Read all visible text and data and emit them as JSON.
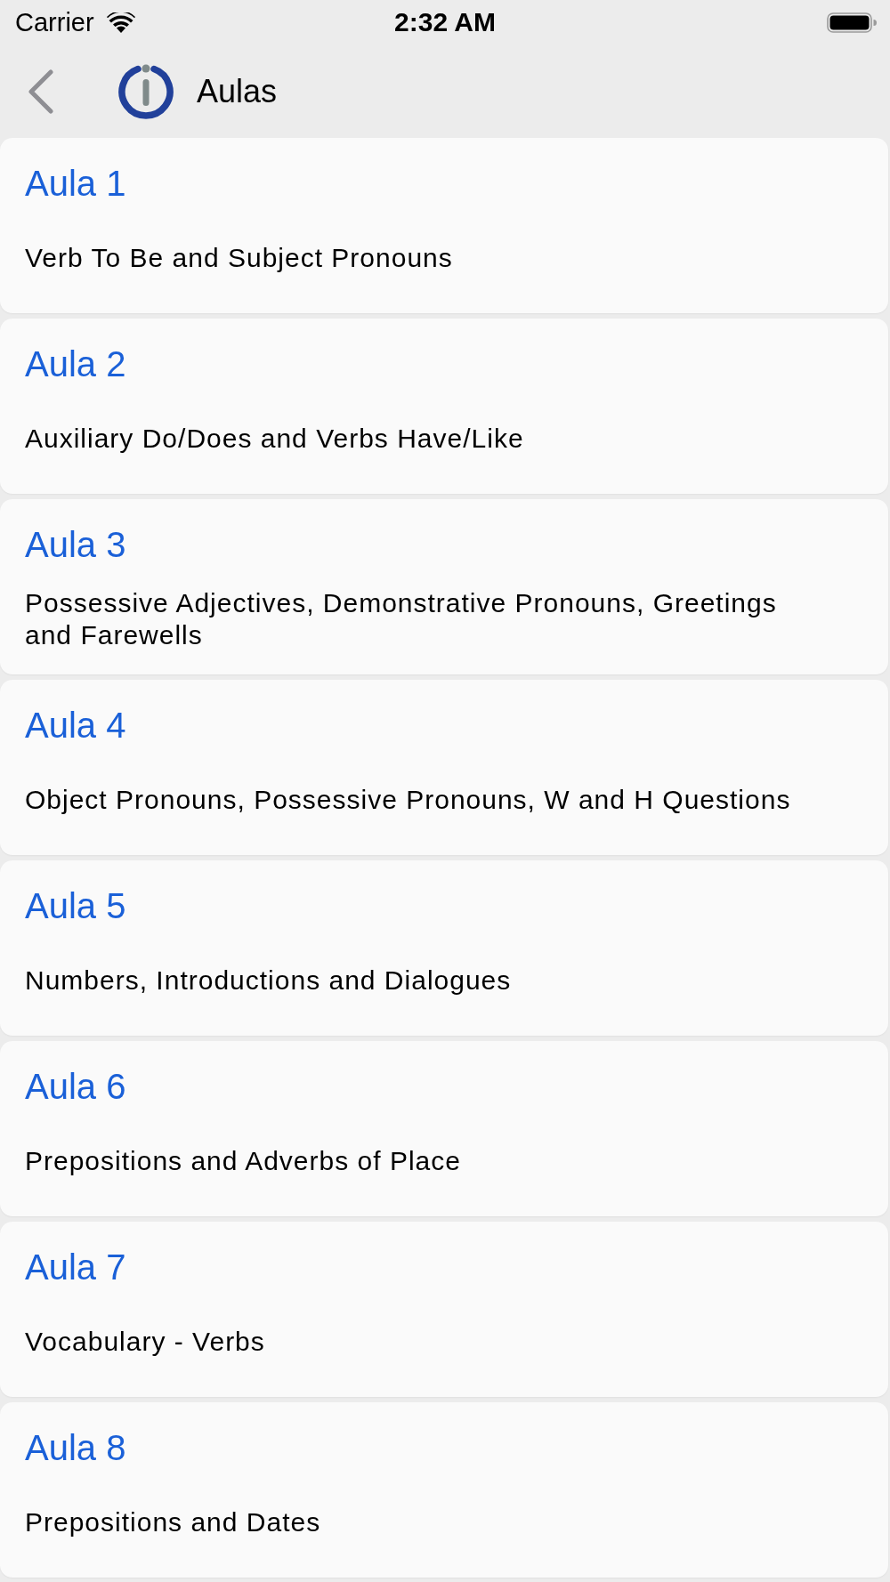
{
  "status_bar": {
    "carrier": "Carrier",
    "time": "2:32 AM"
  },
  "nav_bar": {
    "title": "Aulas"
  },
  "lessons": [
    {
      "title": "Aula 1",
      "subtitle": "Verb To Be and Subject Pronouns"
    },
    {
      "title": "Aula 2",
      "subtitle": "Auxiliary Do/Does and Verbs Have/Like"
    },
    {
      "title": "Aula 3",
      "subtitle": "Possessive Adjectives, Demonstrative Pronouns, Greetings and Farewells"
    },
    {
      "title": "Aula 4",
      "subtitle": "Object Pronouns, Possessive Pronouns, W and H Questions"
    },
    {
      "title": "Aula 5",
      "subtitle": "Numbers, Introductions and Dialogues"
    },
    {
      "title": "Aula 6",
      "subtitle": "Prepositions and Adverbs of Place"
    },
    {
      "title": "Aula 7",
      "subtitle": "Vocabulary - Verbs"
    },
    {
      "title": "Aula 8",
      "subtitle": "Prepositions and Dates"
    }
  ]
}
